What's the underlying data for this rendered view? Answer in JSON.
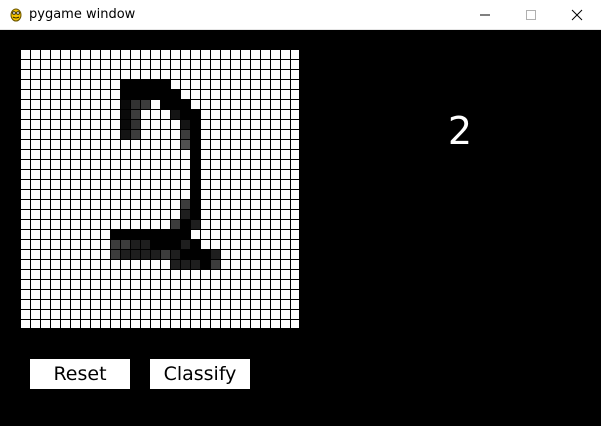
{
  "window": {
    "title": "pygame window",
    "icon": "pygame-snake-icon",
    "controls": [
      "minimize-icon",
      "maximize-icon",
      "close-icon"
    ]
  },
  "canvas": {
    "rows": 28,
    "cols": 28,
    "background_color": "#ffffff",
    "gridline_color": "#000000",
    "painted_pixels": [
      [
        3,
        10,
        0
      ],
      [
        3,
        11,
        0
      ],
      [
        3,
        12,
        0
      ],
      [
        3,
        13,
        0
      ],
      [
        3,
        14,
        0
      ],
      [
        4,
        10,
        0
      ],
      [
        4,
        11,
        0
      ],
      [
        4,
        12,
        0
      ],
      [
        4,
        13,
        0
      ],
      [
        4,
        14,
        0
      ],
      [
        4,
        15,
        0
      ],
      [
        5,
        10,
        10
      ],
      [
        5,
        11,
        50
      ],
      [
        5,
        12,
        60
      ],
      [
        5,
        14,
        0
      ],
      [
        5,
        15,
        0
      ],
      [
        5,
        16,
        0
      ],
      [
        6,
        10,
        10
      ],
      [
        6,
        11,
        60
      ],
      [
        6,
        15,
        20
      ],
      [
        6,
        16,
        0
      ],
      [
        6,
        17,
        0
      ],
      [
        7,
        10,
        10
      ],
      [
        7,
        11,
        50
      ],
      [
        7,
        16,
        20
      ],
      [
        7,
        17,
        0
      ],
      [
        8,
        10,
        20
      ],
      [
        8,
        11,
        60
      ],
      [
        8,
        16,
        60
      ],
      [
        8,
        17,
        0
      ],
      [
        9,
        17,
        0
      ],
      [
        10,
        17,
        0
      ],
      [
        11,
        17,
        0
      ],
      [
        12,
        17,
        0
      ],
      [
        13,
        17,
        0
      ],
      [
        14,
        17,
        0
      ],
      [
        9,
        16,
        80
      ],
      [
        15,
        16,
        60
      ],
      [
        15,
        17,
        0
      ],
      [
        16,
        16,
        30
      ],
      [
        16,
        17,
        0
      ],
      [
        17,
        15,
        60
      ],
      [
        17,
        16,
        0
      ],
      [
        17,
        17,
        30
      ],
      [
        18,
        9,
        0
      ],
      [
        18,
        10,
        0
      ],
      [
        18,
        11,
        0
      ],
      [
        18,
        12,
        0
      ],
      [
        18,
        13,
        0
      ],
      [
        18,
        14,
        0
      ],
      [
        18,
        15,
        0
      ],
      [
        18,
        16,
        0
      ],
      [
        19,
        9,
        60
      ],
      [
        19,
        10,
        60
      ],
      [
        19,
        11,
        30
      ],
      [
        19,
        12,
        30
      ],
      [
        19,
        13,
        0
      ],
      [
        19,
        14,
        0
      ],
      [
        19,
        15,
        0
      ],
      [
        19,
        16,
        30
      ],
      [
        19,
        17,
        0
      ],
      [
        20,
        9,
        60
      ],
      [
        20,
        10,
        30
      ],
      [
        20,
        11,
        30
      ],
      [
        20,
        12,
        30
      ],
      [
        20,
        13,
        30
      ],
      [
        20,
        14,
        60
      ],
      [
        20,
        15,
        30
      ],
      [
        20,
        16,
        0
      ],
      [
        20,
        17,
        0
      ],
      [
        20,
        18,
        0
      ],
      [
        20,
        19,
        30
      ],
      [
        21,
        15,
        30
      ],
      [
        21,
        16,
        30
      ],
      [
        21,
        17,
        30
      ],
      [
        21,
        18,
        0
      ],
      [
        21,
        19,
        60
      ]
    ]
  },
  "prediction": {
    "value": "2"
  },
  "buttons": {
    "reset_label": "Reset",
    "classify_label": "Classify"
  }
}
